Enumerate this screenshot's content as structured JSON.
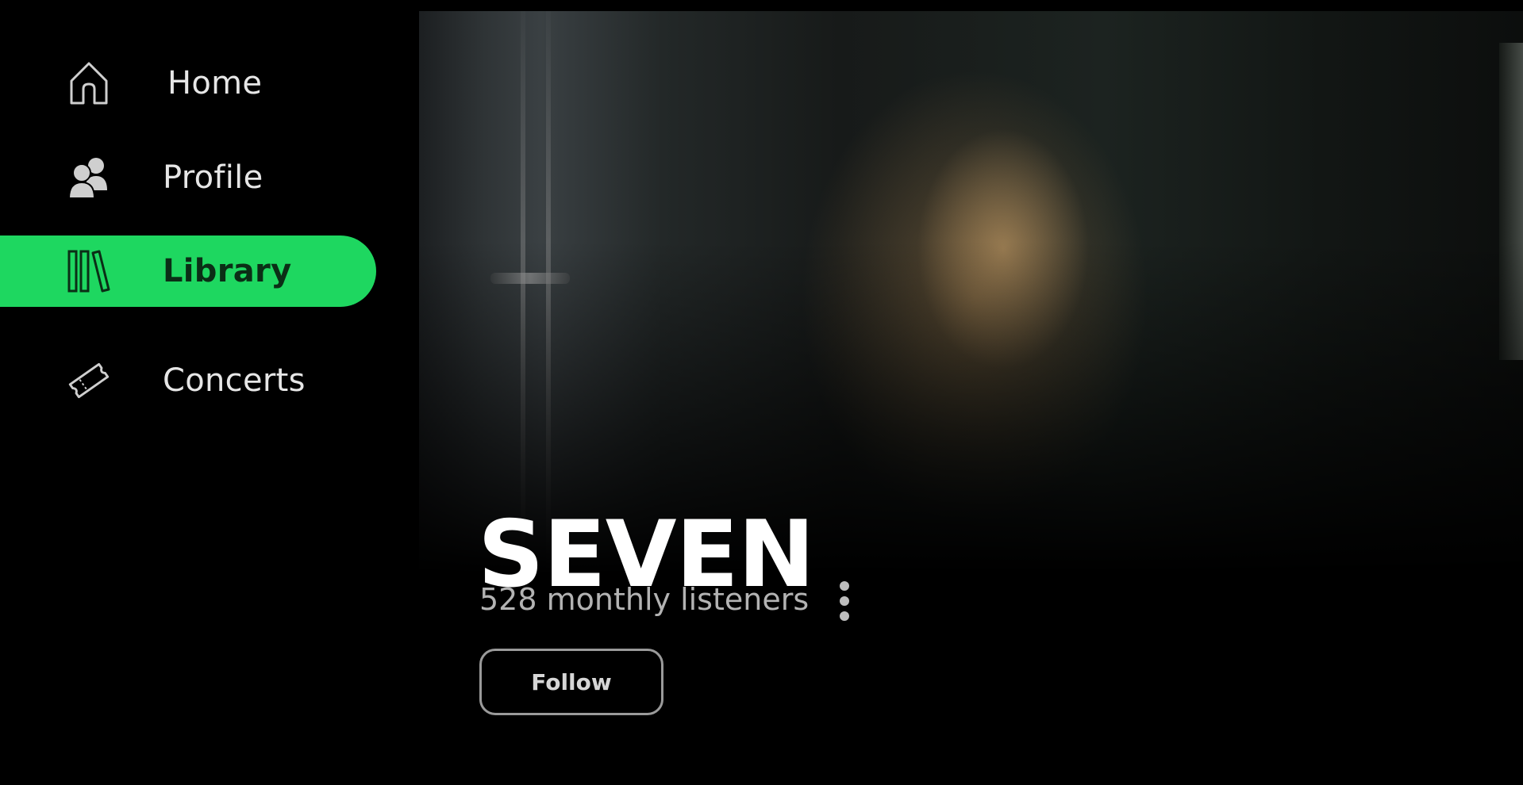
{
  "sidebar": {
    "items": [
      {
        "label": "Home",
        "icon": "home-icon",
        "active": false
      },
      {
        "label": "Profile",
        "icon": "users-icon",
        "active": false
      },
      {
        "label": "Library",
        "icon": "library-icon",
        "active": true
      },
      {
        "label": "Concerts",
        "icon": "ticket-icon",
        "active": false
      }
    ],
    "accent_color": "#1ed760"
  },
  "artist": {
    "name": "SEVEN",
    "monthly_listeners": "528 monthly listeners",
    "follow_label": "Follow",
    "more_icon": "more-vertical-icon"
  }
}
